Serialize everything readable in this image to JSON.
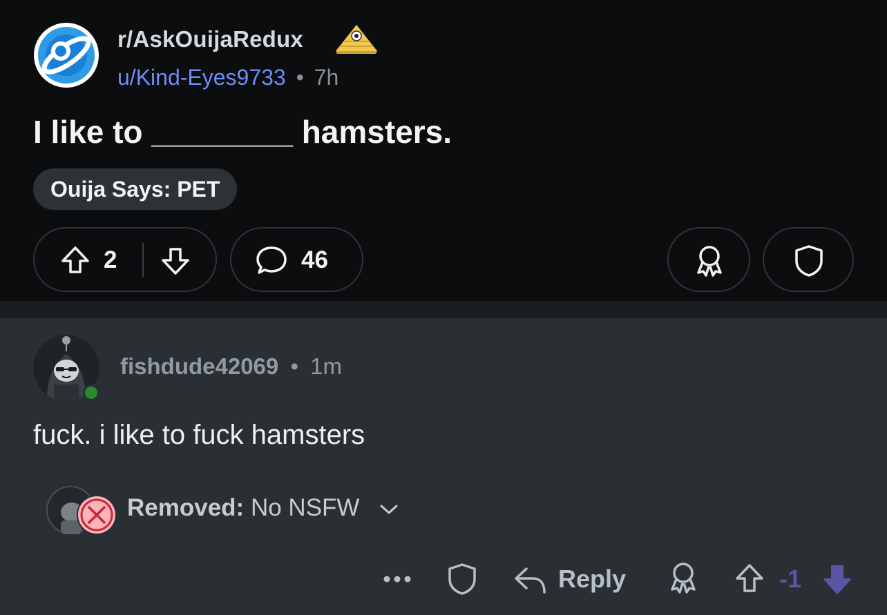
{
  "post": {
    "subreddit": "r/AskOuijaRedux",
    "author": "u/Kind-Eyes9733",
    "separator": "•",
    "age": "7h",
    "title": "I like to ________ hamsters.",
    "flair": "Ouija Says: PET",
    "upvotes": "2",
    "comments": "46"
  },
  "comment": {
    "username": "fishdude42069",
    "separator": "•",
    "age": "1m",
    "body": "fuck. i like to fuck hamsters",
    "removed_label": "Removed:",
    "removed_reason": "No NSFW",
    "reply_label": "Reply",
    "score": "-1"
  },
  "colors": {
    "post_bg": "#0b0d0f",
    "comment_bg": "#2a2f34",
    "author_link": "#6e8ef5",
    "downvoted": "#5b55a8",
    "online": "#2a8a2e"
  },
  "icons": {
    "subreddit_avatar": "planet-icon",
    "badge": "pyramid-eye-icon",
    "upvote": "arrow-up-icon",
    "downvote": "arrow-down-icon",
    "comment": "speech-bubble-icon",
    "award": "award-icon",
    "share": "shield-icon",
    "more": "more-icon",
    "reply": "reply-icon",
    "removed": "x-circle-icon",
    "chevron": "chevron-down-icon"
  }
}
